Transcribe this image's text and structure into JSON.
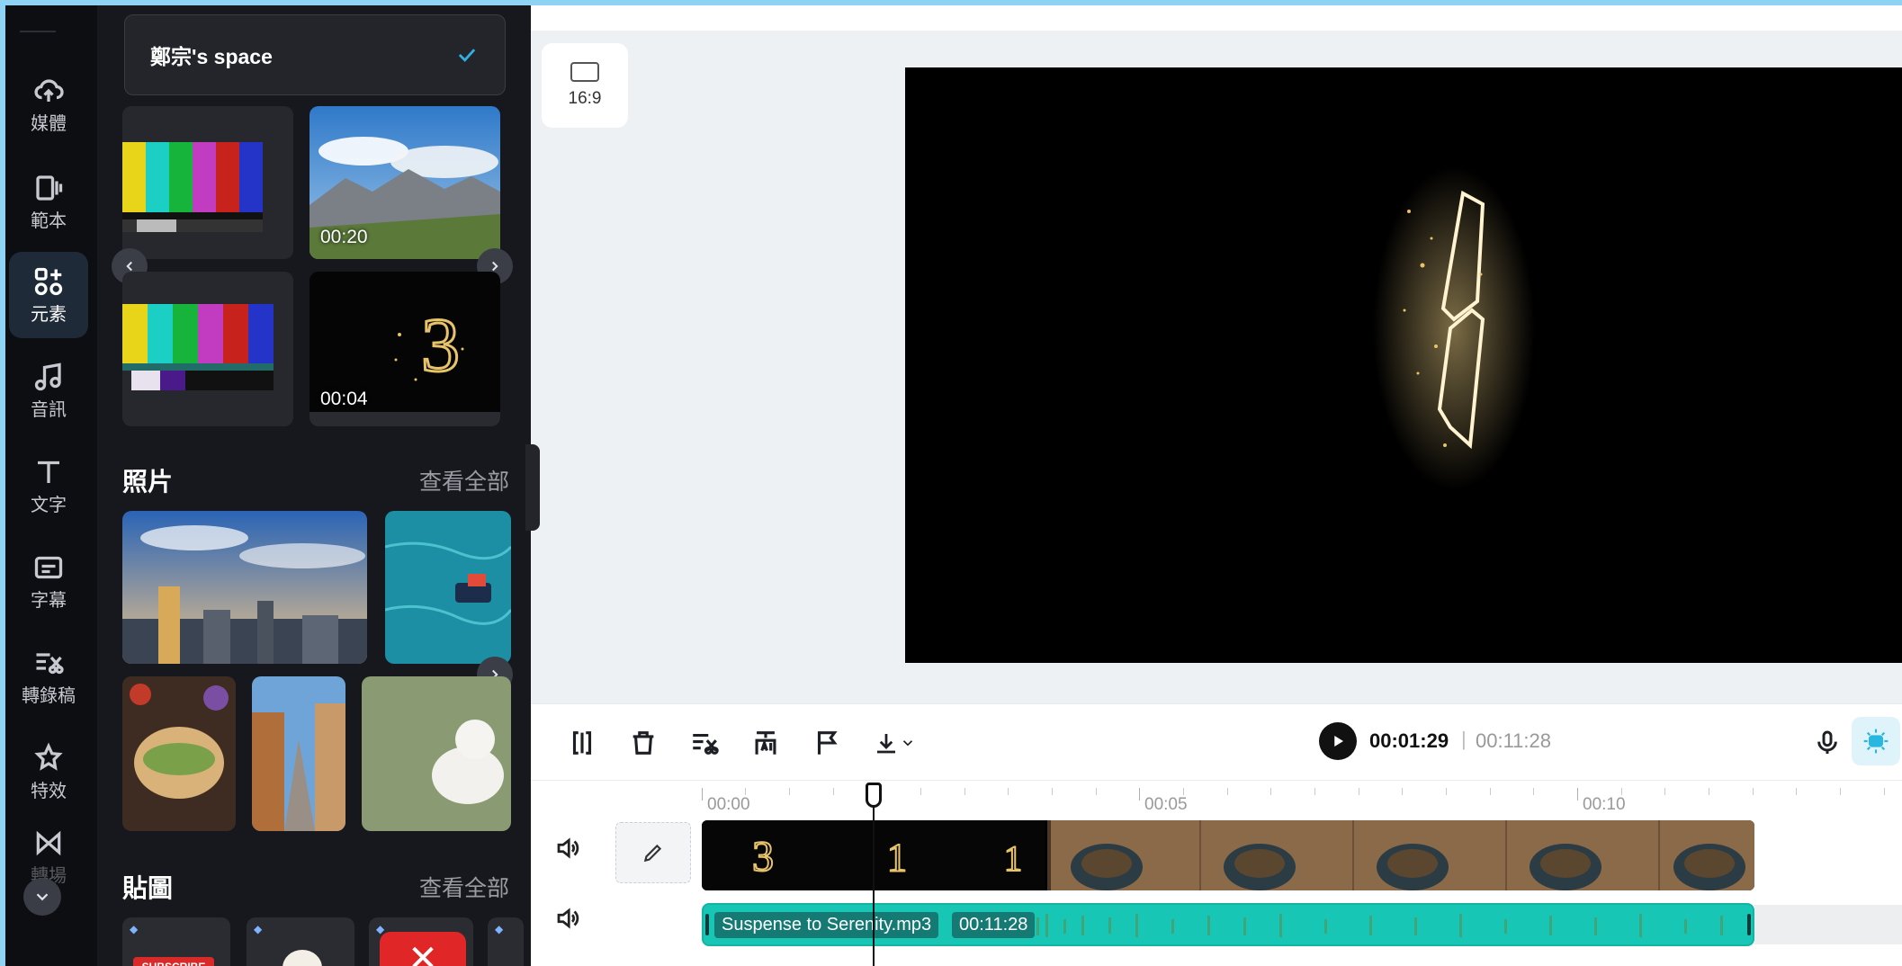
{
  "rail": {
    "items": [
      {
        "label": "媒體",
        "icon": "cloud-upload-icon"
      },
      {
        "label": "範本",
        "icon": "template-icon"
      },
      {
        "label": "元素",
        "icon": "elements-icon",
        "active": true
      },
      {
        "label": "音訊",
        "icon": "music-note-icon"
      },
      {
        "label": "文字",
        "icon": "text-icon"
      },
      {
        "label": "字幕",
        "icon": "captions-icon"
      },
      {
        "label": "轉錄稿",
        "icon": "transcript-icon"
      },
      {
        "label": "特效",
        "icon": "effects-icon"
      },
      {
        "label": "轉場",
        "icon": "transition-icon"
      }
    ]
  },
  "panel": {
    "space_name": "鄭宗's space",
    "videos": [
      {
        "duration": ""
      },
      {
        "duration": "00:20"
      },
      {
        "duration": ""
      },
      {
        "duration": "00:04"
      }
    ],
    "photos": {
      "title": "照片",
      "see_all": "查看全部"
    },
    "stickers": {
      "title": "貼圖",
      "see_all": "查看全部",
      "first_sticker_text": "SUBSCRIBE"
    }
  },
  "canvas": {
    "aspect_ratio": "16:9"
  },
  "player": {
    "current_time": "00:01:29",
    "separator": "|",
    "total_time": "00:11:28"
  },
  "timeline": {
    "ruler": [
      "00:00",
      "00:05",
      "00:10"
    ],
    "audio_clip": {
      "name": "Suspense to Serenity.mp3",
      "duration": "00:11:28"
    }
  },
  "colors": {
    "accent": "#18c6b5",
    "frame": "#8fd3f4"
  }
}
